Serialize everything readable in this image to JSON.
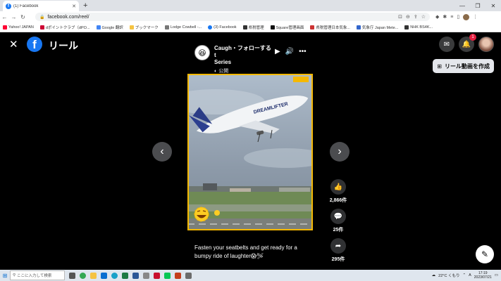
{
  "browser": {
    "tab_title": "(1) Facebook",
    "tab_close": "✕",
    "new_tab": "+",
    "url": "facebook.com/reel/",
    "window_controls": [
      "—",
      "❐",
      "✕"
    ],
    "bookmarks": [
      {
        "label": "Yahoo! JAPAN",
        "color": "#ff0033"
      },
      {
        "label": "dポイントクラブ（dPO...",
        "color": "#cc0033"
      },
      {
        "label": "Google 翻訳",
        "color": "#4285f4"
      },
      {
        "label": "ブックマーク",
        "color": "#f5c342"
      },
      {
        "label": "Lodge Cowbell -...",
        "color": "#777777"
      },
      {
        "label": "(3) Facebook",
        "color": "#1877f2"
      },
      {
        "label": "県税管理",
        "color": "#333333"
      },
      {
        "label": "Square管理画面",
        "color": "#111111"
      },
      {
        "label": "県税管理日本気象...",
        "color": "#cc3333"
      },
      {
        "label": "気象庁 Japan Mete...",
        "color": "#3366cc"
      },
      {
        "label": "NHK BS4K...",
        "color": "#333333"
      }
    ]
  },
  "page": {
    "title": "リール",
    "close_icon": "✕",
    "fb_letter": "f",
    "notification_count": "1",
    "create_reel_label": "リール動画を作成"
  },
  "reel": {
    "channel_name_line1": "Caugh",
    "follow_label": "・フォローする",
    "channel_name_line2": "t",
    "channel_name_line3": "Series",
    "visibility_label": "公開",
    "caption": "Fasten your seatbelts and get ready for a bumpy ride of laughter😱🛩",
    "likes": "2,866件",
    "comments": "25件",
    "shares": "295件"
  },
  "taskbar": {
    "search_placeholder": "ここに入力して検索",
    "weather": "22°C くもり",
    "ime": "A",
    "time": "17:19",
    "date": "2023/07/21"
  },
  "colors": {
    "facebook_blue": "#1877f2",
    "badge_red": "#e41e3f",
    "frame_yellow": "#f5b800"
  }
}
